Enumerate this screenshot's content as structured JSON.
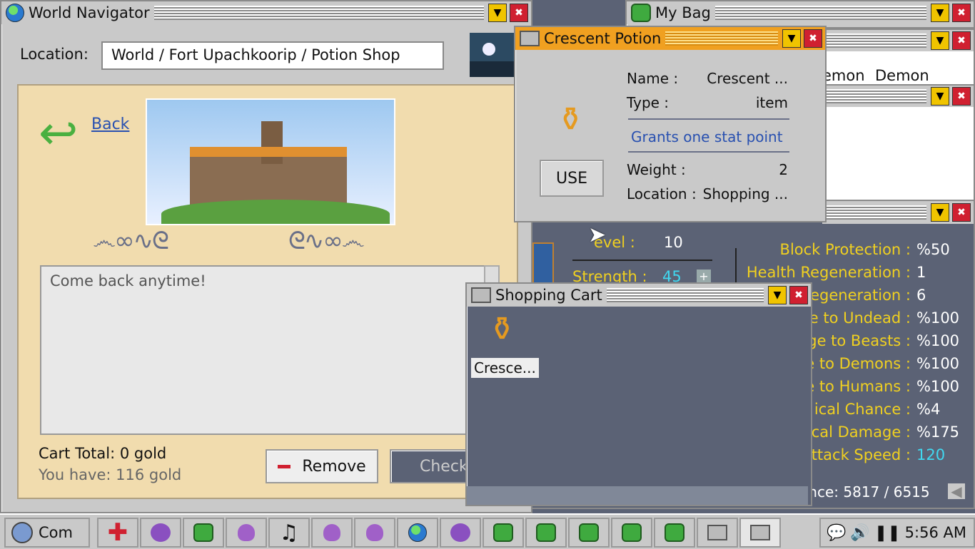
{
  "world_navigator": {
    "title": "World Navigator",
    "location_label": "Location:",
    "location_value": "World / Fort Upachkoorip / Potion Shop",
    "back_label": "Back",
    "message": "Come back anytime!",
    "cart_total": "Cart Total: 0 gold",
    "gold": "You have: 116 gold",
    "remove_label": "Remove",
    "checkout_label": "Check"
  },
  "my_bag": {
    "title": "My Bag",
    "tabs": [
      "emon",
      "Demon"
    ]
  },
  "crescent_potion": {
    "title": "Crescent Potion",
    "name_label": "Name :",
    "name_value": "Crescent ...",
    "type_label": "Type :",
    "type_value": "item",
    "description": "Grants one stat point",
    "use_label": "USE",
    "weight_label": "Weight :",
    "weight_value": "2",
    "location_label": "Location :",
    "location_value": "Shopping ..."
  },
  "stats": {
    "level_label": "evel :",
    "level_value": "10",
    "strength_label": "Strength :",
    "strength_value": "45",
    "rows": [
      {
        "label": "Block Protection :",
        "value": "%50"
      },
      {
        "label": "Health Regeneration :",
        "value": "1"
      },
      {
        "label": "egeneration :",
        "value": "6"
      },
      {
        "label": "e to Undead :",
        "value": "%100"
      },
      {
        "label": "ge to Beasts :",
        "value": "%100"
      },
      {
        "label": "e to Demons :",
        "value": "%100"
      },
      {
        "label": "e to Humans :",
        "value": "%100"
      },
      {
        "label": "ical Chance :",
        "value": "%4"
      },
      {
        "label": "cal Damage :",
        "value": "%175"
      },
      {
        "label": "ttack Speed :",
        "value": "120"
      }
    ],
    "experience": "ence: 5817 / 6515"
  },
  "shopping_cart": {
    "title": "Shopping Cart",
    "item_label": "Cresce..."
  },
  "taskbar": {
    "start_label": "Com",
    "time": "5:56 AM"
  },
  "colors": {
    "parchment": "#f1dcae",
    "stat_yellow": "#f0d020",
    "stat_cyan": "#40d8f0",
    "desc_blue": "#2850b0"
  }
}
